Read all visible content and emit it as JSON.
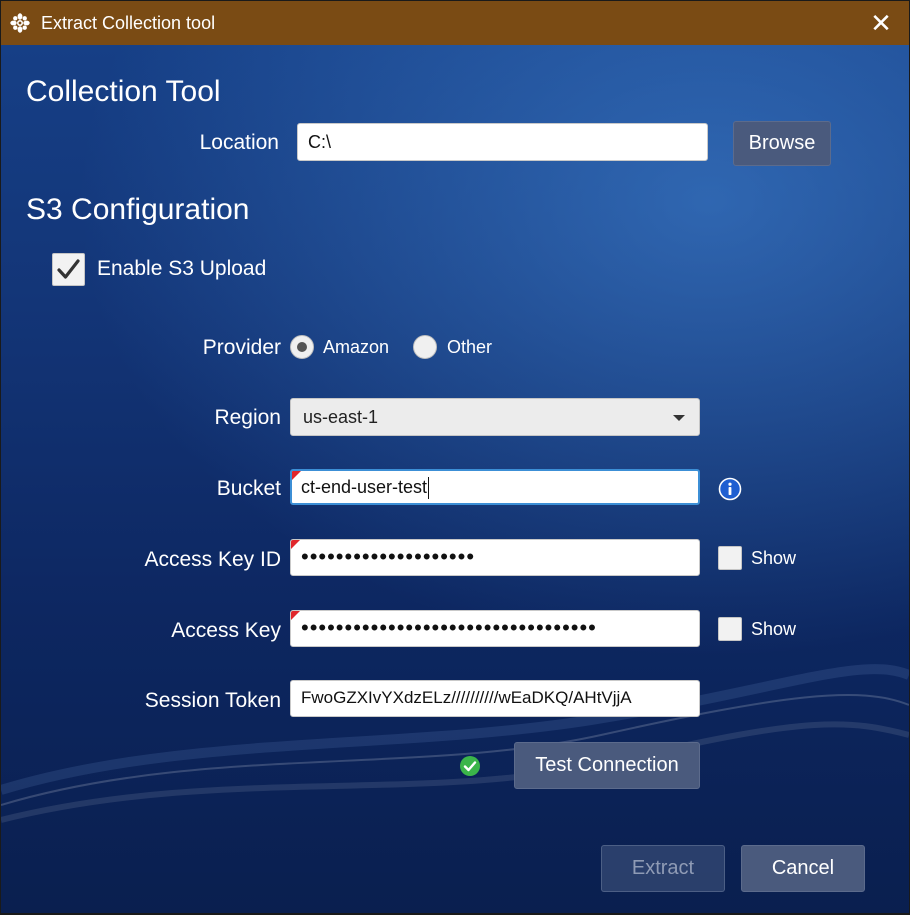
{
  "window": {
    "title": "Extract Collection tool",
    "close_glyph": "✕"
  },
  "collection_tool": {
    "heading": "Collection Tool",
    "location_label": "Location",
    "location_value": "C:\\",
    "browse_label": "Browse"
  },
  "s3": {
    "heading": "S3 Configuration",
    "enable_upload_label": "Enable S3 Upload",
    "enable_upload_checked": true,
    "provider_label": "Provider",
    "provider_options": [
      "Amazon",
      "Other"
    ],
    "provider_selected": "Amazon",
    "region_label": "Region",
    "region_value": "us-east-1",
    "bucket_label": "Bucket",
    "bucket_value": "ct-end-user-test",
    "access_key_id_label": "Access Key ID",
    "access_key_id_value": "••••••••••••••••••••",
    "access_key_label": "Access Key",
    "access_key_value": "••••••••••••••••••••••••••••••••••",
    "show_label": "Show",
    "session_token_label": "Session Token",
    "session_token_value": "FwoGZXIvYXdzELz//////////wEaDKQ/AHtVjjA",
    "test_connection_label": "Test Connection",
    "test_status": "success"
  },
  "footer": {
    "extract_label": "Extract",
    "cancel_label": "Cancel"
  },
  "colors": {
    "titlebar": "#7a4b14",
    "button": "#4a5a7d",
    "focus": "#3c8fd6",
    "required_marker": "#e0262b",
    "success": "#3bb54a"
  },
  "icons": {
    "app": "gear-flower-icon",
    "info": "info-icon",
    "success": "check-circle-icon"
  }
}
